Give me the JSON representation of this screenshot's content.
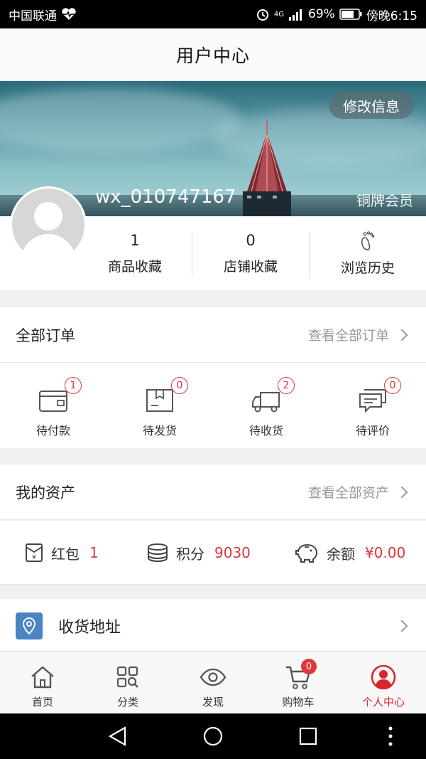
{
  "status_bar": {
    "carrier": "中国联通",
    "network": "4G",
    "battery": "69%",
    "time": "傍晚6:15"
  },
  "header": {
    "title": "用户中心"
  },
  "profile": {
    "edit_button": "修改信息",
    "username": "wx_010747167",
    "member_level": "铜牌会员"
  },
  "stats": [
    {
      "count": "1",
      "label": "商品收藏"
    },
    {
      "count": "0",
      "label": "店铺收藏"
    },
    {
      "label": "浏览历史",
      "icon": "footprint-icon"
    }
  ],
  "orders": {
    "title": "全部订单",
    "view_all": "查看全部订单",
    "items": [
      {
        "label": "待付款",
        "badge": "1",
        "icon": "wallet-icon"
      },
      {
        "label": "待发货",
        "badge": "0",
        "icon": "package-icon"
      },
      {
        "label": "待收货",
        "badge": "2",
        "icon": "truck-icon"
      },
      {
        "label": "待评价",
        "badge": "0",
        "icon": "comment-icon"
      }
    ]
  },
  "assets": {
    "title": "我的资产",
    "view_all": "查看全部资产",
    "items": [
      {
        "label": "红包",
        "value": "1",
        "icon": "red-envelope-icon"
      },
      {
        "label": "积分",
        "value": "9030",
        "icon": "coins-icon"
      },
      {
        "label": "余额",
        "value": "¥0.00",
        "icon": "piggy-bank-icon"
      }
    ]
  },
  "address": {
    "label": "收货地址",
    "icon": "location-pin-icon"
  },
  "tabbar": {
    "items": [
      {
        "label": "首页",
        "icon": "home-icon"
      },
      {
        "label": "分类",
        "icon": "category-icon"
      },
      {
        "label": "发现",
        "icon": "eye-icon"
      },
      {
        "label": "购物车",
        "icon": "cart-icon",
        "badge": "0"
      },
      {
        "label": "个人中心",
        "icon": "user-icon",
        "active": true
      }
    ]
  },
  "colors": {
    "accent_red": "#e0353b",
    "address_blue": "#4a84c4"
  }
}
